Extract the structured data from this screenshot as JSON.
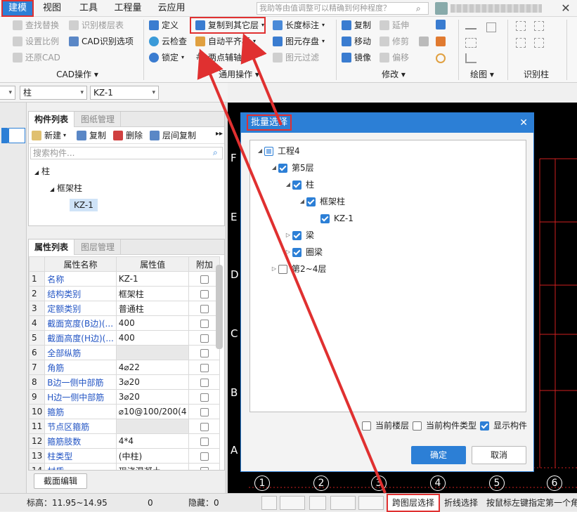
{
  "menu": {
    "items": [
      "建模",
      "视图",
      "工具",
      "工程量",
      "云应用"
    ],
    "active": "建模",
    "search_placeholder": "我助等由值调整可以精确到何种程度？"
  },
  "ribbon": {
    "cad_group": {
      "label": "CAD操作",
      "buttons": [
        "查找替换",
        "识别楼层表",
        "设置比例",
        "CAD识别选项",
        "还原CAD"
      ]
    },
    "common_group": {
      "label": "通用操作",
      "buttons": [
        "定义",
        "复制到其它层",
        "长度标注",
        "云检查",
        "自动平齐板",
        "图元存盘",
        "锁定",
        "两点辅轴",
        "图元过滤"
      ]
    },
    "modify_group": {
      "label": "修改",
      "buttons": [
        "复制",
        "延伸",
        "移动",
        "修剪",
        "镜像",
        "偏移"
      ]
    },
    "draw_group": {
      "label": "绘图"
    },
    "recog_group": {
      "label": "识别柱"
    }
  },
  "filter_bar": {
    "category": "柱",
    "component": "KZ-1"
  },
  "component_panel": {
    "tabs": [
      "构件列表",
      "图纸管理"
    ],
    "toolbar": [
      "新建",
      "复制",
      "删除",
      "层间复制"
    ],
    "search_placeholder": "搜索构件...",
    "tree": [
      "柱",
      "框架柱",
      "KZ-1"
    ]
  },
  "property_panel": {
    "tabs": [
      "属性列表",
      "图层管理"
    ],
    "headers": [
      "属性名称",
      "属性值",
      "附加"
    ],
    "rows": [
      {
        "num": "1",
        "name": "名称",
        "value": "KZ-1"
      },
      {
        "num": "2",
        "name": "结构类别",
        "value": "框架柱"
      },
      {
        "num": "3",
        "name": "定额类别",
        "value": "普通柱"
      },
      {
        "num": "4",
        "name": "截面宽度(B边)(...",
        "value": "400"
      },
      {
        "num": "5",
        "name": "截面高度(H边)(...",
        "value": "400"
      },
      {
        "num": "6",
        "name": "全部纵筋",
        "value": ""
      },
      {
        "num": "7",
        "name": "角筋",
        "value": "4⌀22"
      },
      {
        "num": "8",
        "name": "B边一侧中部筋",
        "value": "3⌀20"
      },
      {
        "num": "9",
        "name": "H边一侧中部筋",
        "value": "3⌀20"
      },
      {
        "num": "10",
        "name": "箍筋",
        "value": "⌀10@100/200(4"
      },
      {
        "num": "11",
        "name": "节点区箍筋",
        "value": ""
      },
      {
        "num": "12",
        "name": "箍筋肢数",
        "value": "4*4"
      },
      {
        "num": "13",
        "name": "柱类型",
        "value": "(中柱)"
      },
      {
        "num": "14",
        "name": "材质",
        "value": "现浇混凝土"
      }
    ],
    "section_edit": "截面编辑"
  },
  "dialog": {
    "title": "批量选择",
    "tree": [
      {
        "label": "工程4",
        "state": "partial"
      },
      {
        "label": "第5层",
        "state": "checked"
      },
      {
        "label": "柱",
        "state": "checked"
      },
      {
        "label": "框架柱",
        "state": "checked"
      },
      {
        "label": "KZ-1",
        "state": "checked"
      },
      {
        "label": "梁",
        "state": "checked"
      },
      {
        "label": "圈梁",
        "state": "checked"
      },
      {
        "label": "第2~4层",
        "state": "unchecked"
      }
    ],
    "options": [
      {
        "label": "当前楼层",
        "checked": false
      },
      {
        "label": "当前构件类型",
        "checked": false
      },
      {
        "label": "显示构件",
        "checked": true
      }
    ],
    "ok": "确定",
    "cancel": "取消"
  },
  "canvas": {
    "row_axes": [
      "F",
      "E",
      "D",
      "C",
      "B",
      "A"
    ],
    "col_axes": [
      "1",
      "2",
      "3",
      "4",
      "5",
      "6"
    ]
  },
  "status": {
    "elevation": "标高：11.95~14.95",
    "elev_zero": "0",
    "hidden": "隐藏：0",
    "cross_layer": "跨图层选择",
    "polyline": "折线选择",
    "hint": "按鼠标左键指定第一个角"
  },
  "colors": {
    "accent": "#2c7fd6",
    "highlight": "#e03030",
    "grid": "#d02020"
  }
}
